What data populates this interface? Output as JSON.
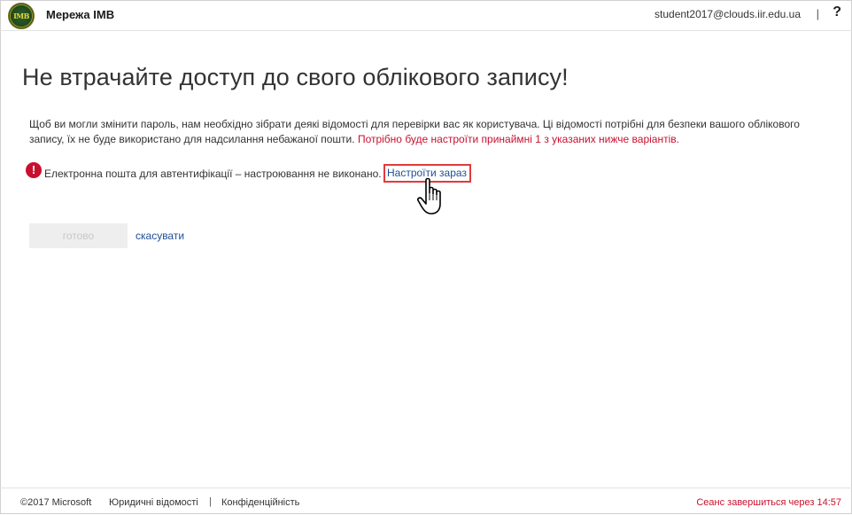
{
  "header": {
    "logo_text": "IMB",
    "org_name": "Мережа IMB",
    "user_email": "student2017@clouds.iir.edu.ua",
    "separator": "|",
    "help": "?"
  },
  "main": {
    "title": "Не втрачайте доступ до свого облікового запису!",
    "description": "Щоб ви могли змінити пароль, нам необхідно зібрати деякі відомості для перевірки вас як користувача. Ці відомості потрібні для безпеки вашого облікового запису, їх не буде використано для надсилання небажаної пошти.",
    "description_warning": "Потрібно буде настроїти принаймні 1 з указаних нижче варіантів.",
    "alert_symbol": "!",
    "auth_item": "Електронна пошта для автентифікації – настроювання не виконано.",
    "setup_link": "Настроїти зараз",
    "done_button": "готово",
    "cancel_link": "скасувати"
  },
  "footer": {
    "copyright": "©2017 Microsoft",
    "legal": "Юридичні відомості",
    "separator": "|",
    "privacy": "Конфіденційність",
    "session": "Сеанс завершиться через 14:57"
  },
  "colors": {
    "accent_link": "#1f4e96",
    "warning": "#c8102e",
    "highlight_box": "#e23b3b"
  },
  "icons": [
    "imb-logo-icon",
    "alert-icon",
    "hand-pointer-icon"
  ]
}
